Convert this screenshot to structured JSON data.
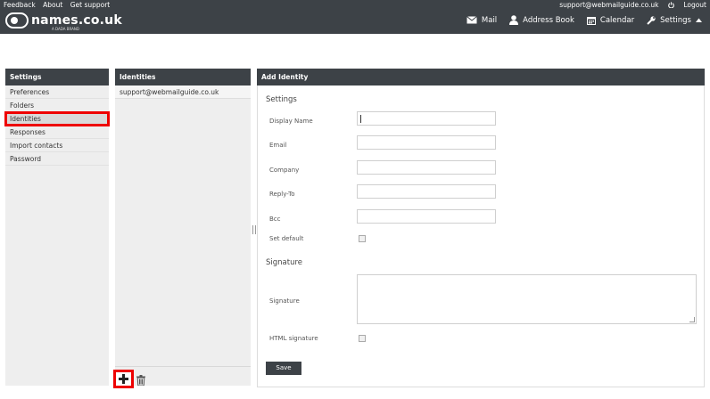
{
  "topbar": {
    "links": [
      "Feedback",
      "About",
      "Get support"
    ],
    "user_email": "support@webmailguide.co.uk",
    "logout_label": "Logout",
    "logo_text": "names.co.uk",
    "logo_subtext": "A DADA BRAND"
  },
  "nav": {
    "mail": "Mail",
    "address_book": "Address Book",
    "calendar": "Calendar",
    "settings": "Settings"
  },
  "settings_panel": {
    "title": "Settings",
    "items": [
      "Preferences",
      "Folders",
      "Identities",
      "Responses",
      "Import contacts",
      "Password"
    ],
    "selected": "Identities"
  },
  "identities_panel": {
    "title": "Identities",
    "items": [
      "support@webmailguide.co.uk"
    ]
  },
  "add_identity": {
    "title": "Add Identity",
    "settings_heading": "Settings",
    "fields": {
      "display_name": {
        "label": "Display Name",
        "value": ""
      },
      "email": {
        "label": "Email",
        "value": ""
      },
      "company": {
        "label": "Company",
        "value": ""
      },
      "reply_to": {
        "label": "Reply-To",
        "value": ""
      },
      "bcc": {
        "label": "Bcc",
        "value": ""
      }
    },
    "set_default_label": "Set default",
    "signature_heading": "Signature",
    "signature_label": "Signature",
    "html_signature_label": "HTML signature",
    "save_label": "Save"
  },
  "colors": {
    "header_bg": "#3d4247",
    "highlight": "#e00000"
  }
}
